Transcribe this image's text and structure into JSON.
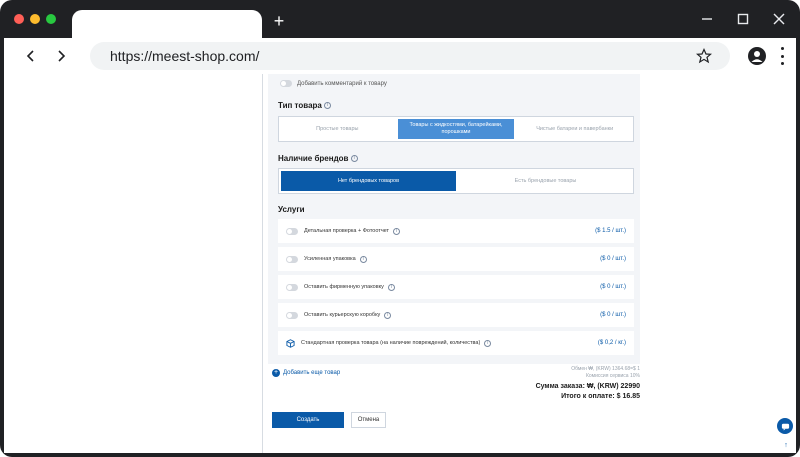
{
  "browser": {
    "url": "https://meest-shop.com/",
    "colors": {
      "red": "#ff5f57",
      "yellow": "#febc2e",
      "green": "#28c840"
    }
  },
  "form": {
    "comment_toggle_label": "Добавить комментарий к товару",
    "product_type": {
      "title": "Тип товара",
      "options": [
        "Простые товары",
        "Товары с жидкостями, батарейками, порошками",
        "Чистые батареи и павербанки"
      ],
      "selected_index": 1
    },
    "brands": {
      "title": "Наличие брендов",
      "options": [
        "Нет брендовых товаров",
        "Есть брендовые товары"
      ],
      "selected_index": 0
    },
    "services": {
      "title": "Услуги",
      "items": [
        {
          "label": "Детальная проверка + Фотоотчет",
          "price": "($ 1.5 / шт.)",
          "icon": "toggle"
        },
        {
          "label": "Усиленная упаковка",
          "price": "($ 0 / шт.)",
          "icon": "toggle"
        },
        {
          "label": "Оставить фирменную упаковку",
          "price": "($ 0 / шт.)",
          "icon": "toggle"
        },
        {
          "label": "Оставить курьерскую коробку",
          "price": "($ 0 / шт.)",
          "icon": "toggle"
        },
        {
          "label": "Стандартная проверка товара (на наличие повреждений, количества)",
          "price": "($ 0,2 / кг.)",
          "icon": "box-icon"
        }
      ]
    },
    "add_item_label": "Добавить еще товар",
    "summary": {
      "exchange": "Обмен ₩, (KRW) 1364.68=$ 1",
      "commission": "Комиссия сервиса 10%",
      "order_sum": "Сумма заказа: ₩, (KRW) 22990",
      "total": "Итого к оплате: $ 16.85"
    },
    "buttons": {
      "create": "Создать",
      "cancel": "Отмена"
    },
    "accent_color": "#0a5aa8"
  }
}
